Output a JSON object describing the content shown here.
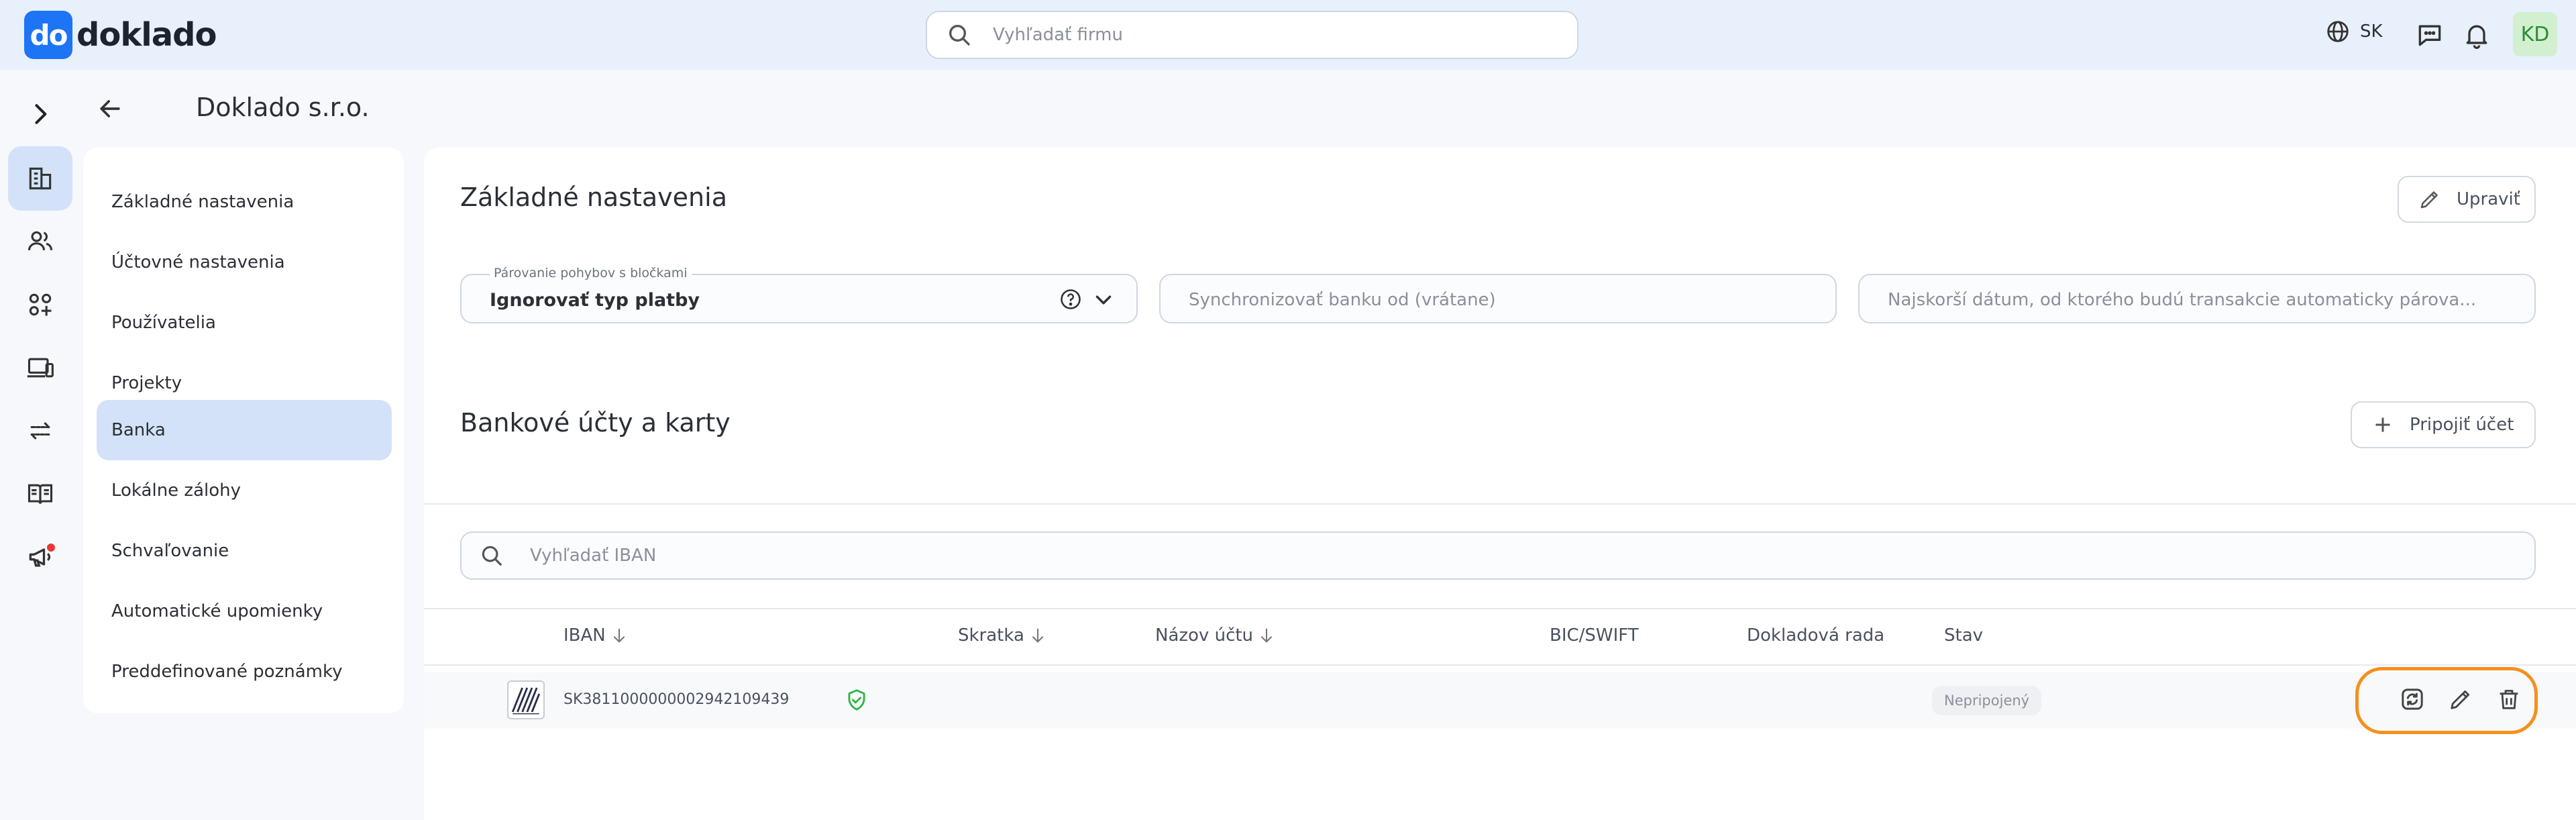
{
  "app": {
    "logo_mark": "do",
    "logo_text": "doklado"
  },
  "topbar": {
    "search_placeholder": "Vyhľadať firmu",
    "language": "SK",
    "avatar_initials": "KD",
    "icons": [
      "search-icon",
      "globe-icon",
      "chat-icon",
      "bell-icon"
    ]
  },
  "rail": {
    "items": [
      "expand-chevron",
      "companies-icon",
      "users-icon",
      "apps-icon",
      "devices-icon",
      "transfers-icon",
      "book-icon",
      "announcements-icon"
    ],
    "active": "companies-icon",
    "notification_color": "#e53935"
  },
  "page": {
    "company_name": "Doklado s.r.o."
  },
  "settings_nav": {
    "items": [
      "Základné nastavenia",
      "Účtovné nastavenia",
      "Používatelia",
      "Projekty",
      "Banka",
      "Lokálne zálohy",
      "Schvaľovanie",
      "Automatické upomienky",
      "Preddefinované poznámky"
    ],
    "active": "Banka"
  },
  "basic": {
    "title": "Základné nastavenia",
    "edit_label": "Upraviť",
    "pairing_label": "Párovanie pohybov s bločkami",
    "pairing_value": "Ignorovať typ platby",
    "sync_placeholder": "Synchronizovať banku od (vrátane)",
    "earliest_placeholder": "Najskorší dátum, od ktorého budú transakcie automaticky párova..."
  },
  "bank": {
    "title": "Bankové účty a karty",
    "connect_label": "Pripojiť účet",
    "search_placeholder": "Vyhľadať IBAN",
    "columns": [
      "IBAN",
      "Skratka",
      "Názov účtu",
      "BIC/SWIFT",
      "Dokladová rada",
      "Stav"
    ],
    "rows": [
      {
        "iban": "SK3811000000002942109439",
        "skratka": "",
        "nazov": "",
        "bic": "",
        "rada": "",
        "status": "Nepripojený"
      }
    ]
  },
  "colors": {
    "accent": "#1d74f5",
    "active_bg": "#d3e2f8",
    "highlight": "#f5901e",
    "verified": "#2fb344"
  }
}
